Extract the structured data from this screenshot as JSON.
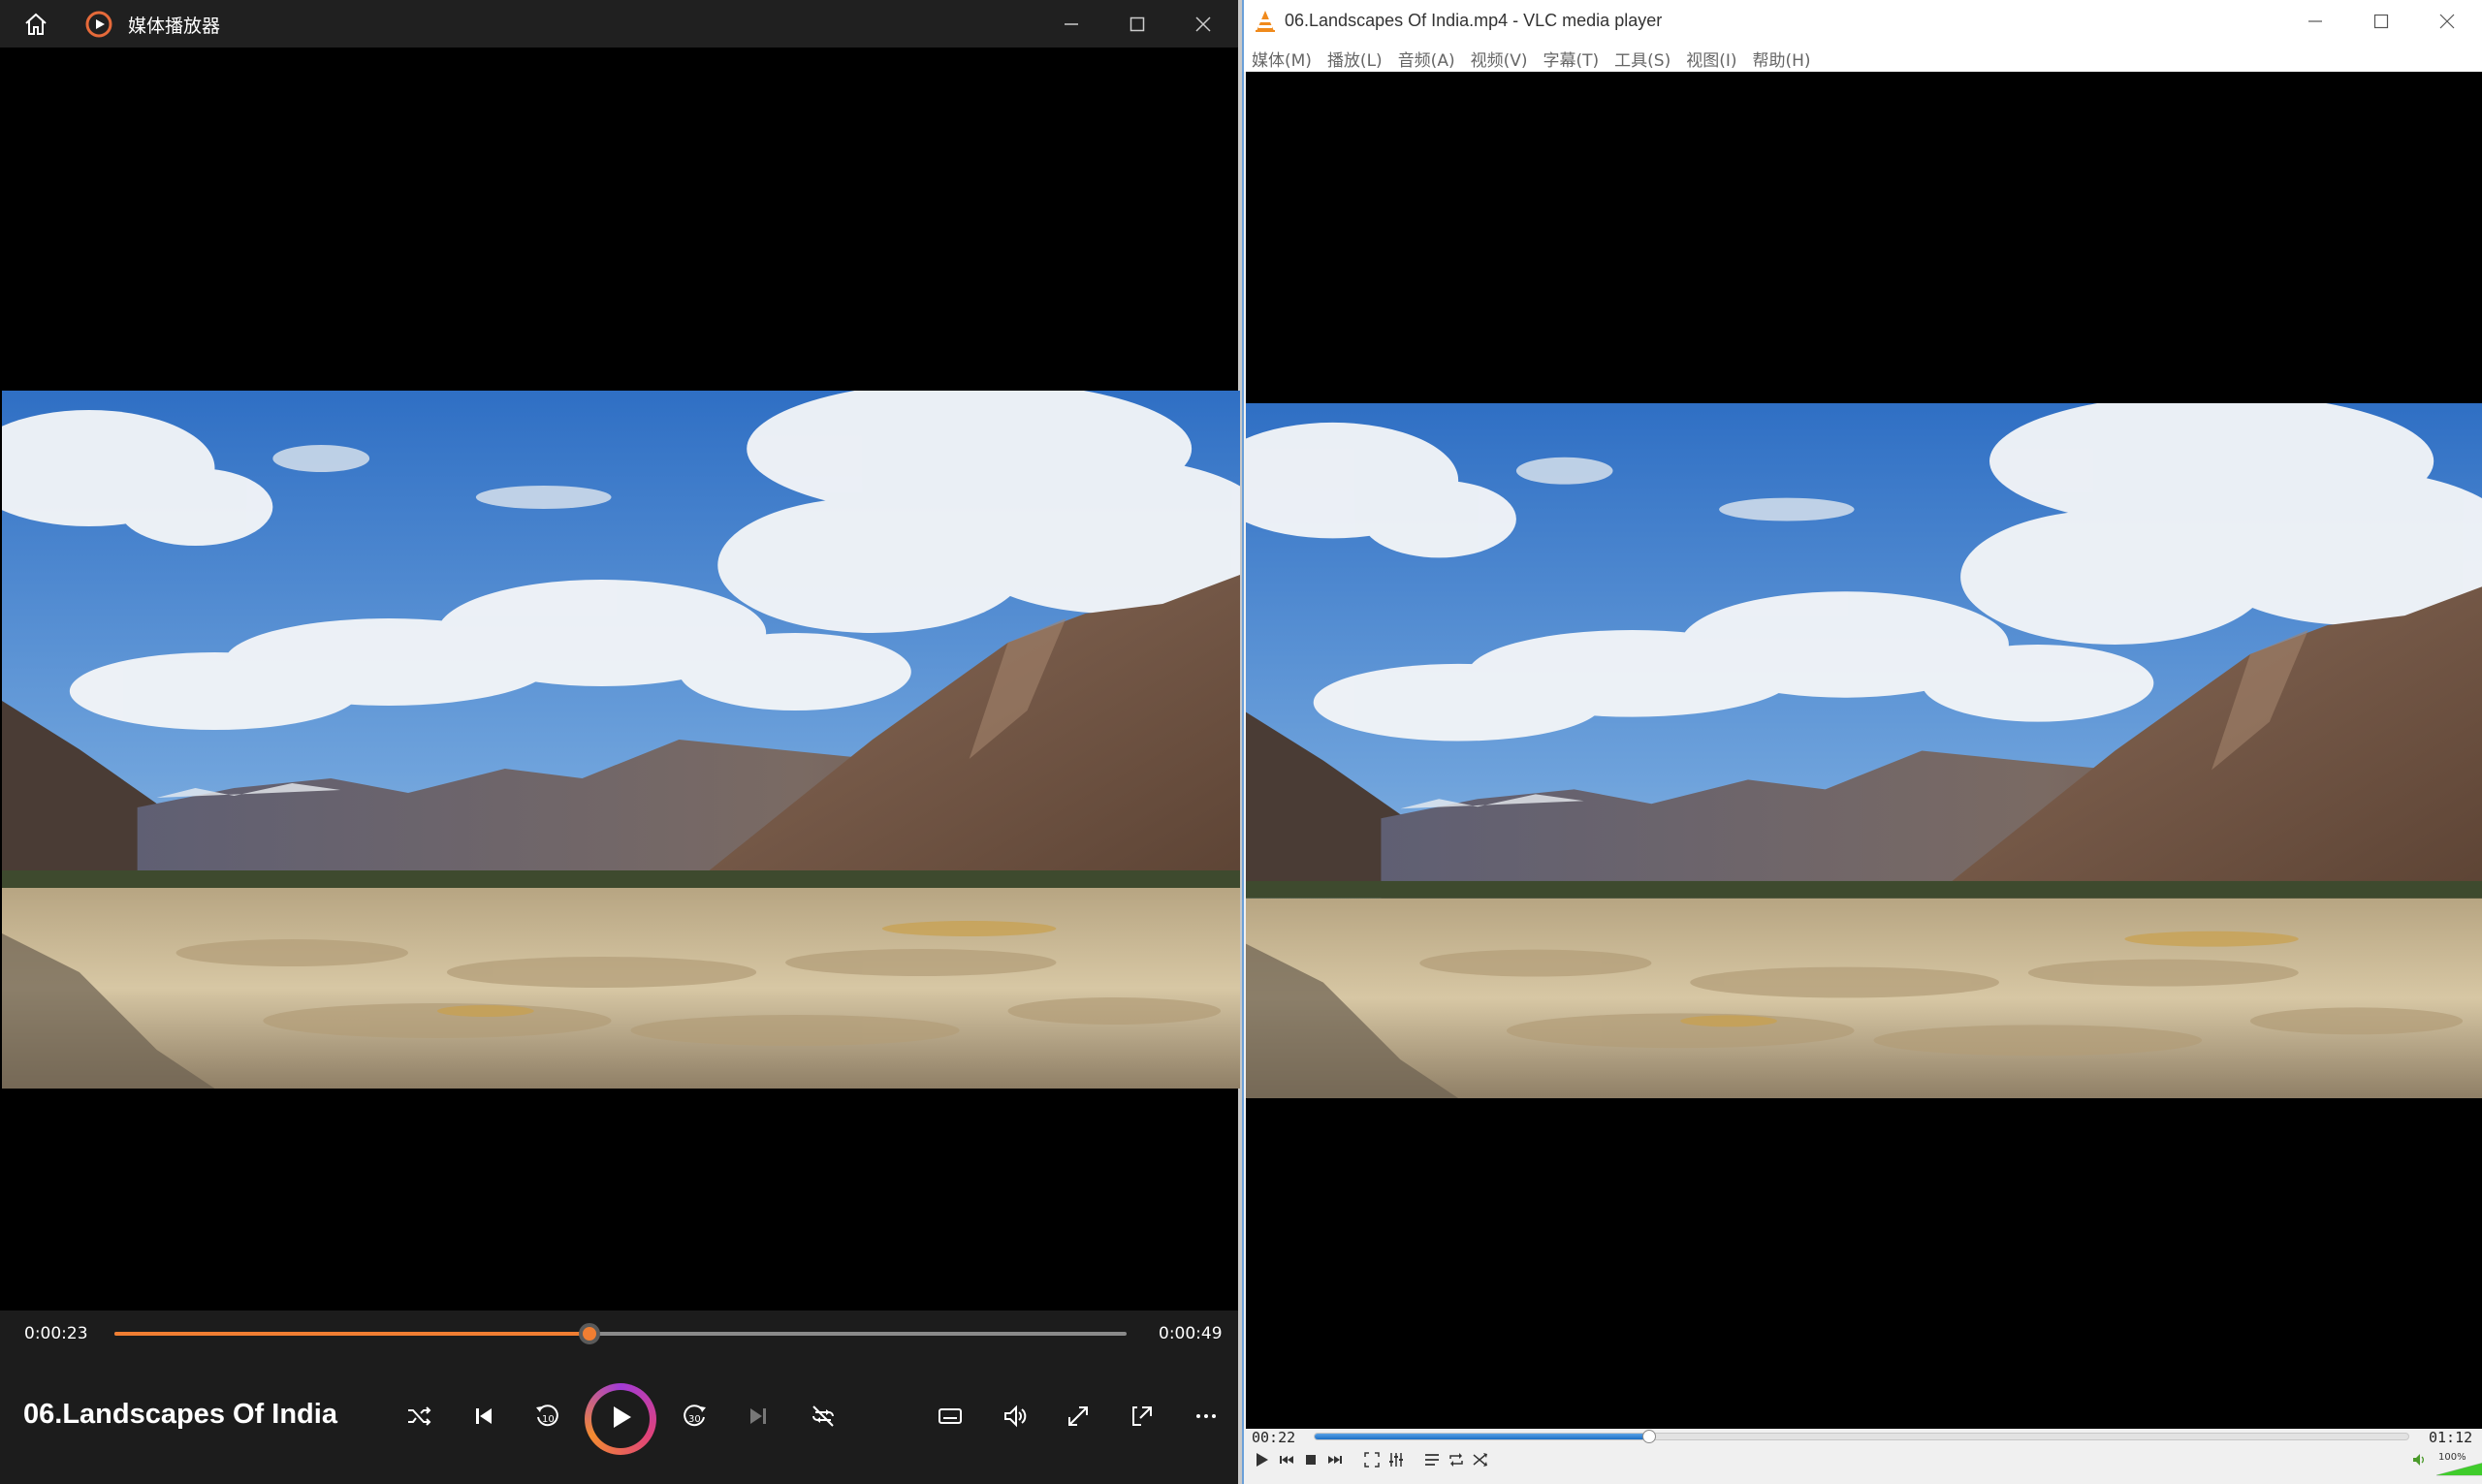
{
  "wmp": {
    "app_title": "媒体播放器",
    "current_time": "0:00:23",
    "total_time": "0:00:49",
    "progress": 0.469,
    "media_title": "06.Landscapes Of India",
    "accent_color": "#f07e32",
    "icons": [
      "home-icon",
      "app-icon",
      "shuffle-icon",
      "previous-icon",
      "rewind-10-icon",
      "play-icon",
      "forward-30-icon",
      "next-icon",
      "repeat-icon",
      "subtitles-icon",
      "volume-icon",
      "fullscreen-icon",
      "miniplayer-icon",
      "more-icon"
    ]
  },
  "vlc": {
    "window_title": "06.Landscapes Of India.mp4 - VLC media player",
    "menu": [
      "媒体(M)",
      "播放(L)",
      "音频(A)",
      "视频(V)",
      "字幕(T)",
      "工具(S)",
      "视图(I)",
      "帮助(H)"
    ],
    "current_time": "00:22",
    "total_time": "01:12",
    "progress": 0.306,
    "volume_label": "100%",
    "volume": 1.0,
    "accent_color": "#1b6fc6",
    "icons": [
      "vlc-cone-icon",
      "play-icon",
      "previous-icon",
      "stop-icon",
      "next-icon",
      "fullscreen-icon",
      "extended-settings-icon",
      "playlist-icon",
      "loop-icon",
      "random-icon",
      "volume-icon"
    ]
  }
}
